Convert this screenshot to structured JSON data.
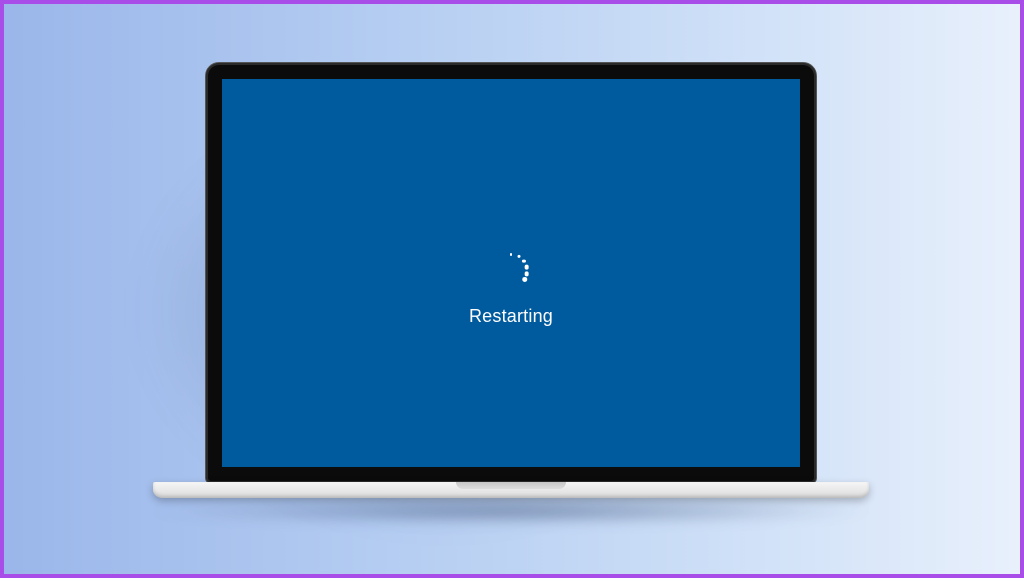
{
  "border_color": "#a84de8",
  "screen": {
    "background_color": "#005a9e",
    "status_text": "Restarting",
    "text_color": "#ffffff"
  },
  "spinner": {
    "dot_color": "#ffffff",
    "radius_px": 16
  }
}
